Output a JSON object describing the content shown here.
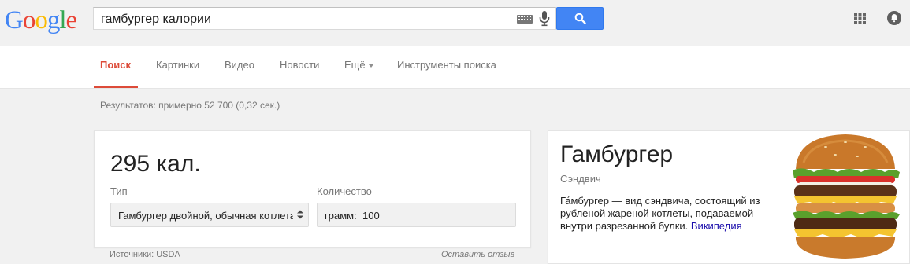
{
  "header": {
    "logo_letters": [
      {
        "ch": "G",
        "color": "#4285f4"
      },
      {
        "ch": "o",
        "color": "#ea4335"
      },
      {
        "ch": "o",
        "color": "#fbbc05"
      },
      {
        "ch": "g",
        "color": "#4285f4"
      },
      {
        "ch": "l",
        "color": "#34a853"
      },
      {
        "ch": "e",
        "color": "#ea4335"
      }
    ],
    "search_query": "гамбургер калории",
    "icons": {
      "keyboard": "keyboard-icon",
      "mic": "microphone-icon",
      "search": "search-icon",
      "apps": "apps-grid-icon",
      "notifications": "bell-icon"
    }
  },
  "nav": {
    "tabs": [
      {
        "label": "Поиск",
        "active": true
      },
      {
        "label": "Картинки",
        "active": false
      },
      {
        "label": "Видео",
        "active": false
      },
      {
        "label": "Новости",
        "active": false
      },
      {
        "label": "Ещё",
        "active": false
      },
      {
        "label": "Инструменты поиска",
        "active": false
      }
    ]
  },
  "results": {
    "stats": "Результатов: примерно 52 700 (0,32 сек.)",
    "calories_card": {
      "value": "295 кал.",
      "type_label": "Тип",
      "type_value": "Гамбургер двойной, обычная котлета",
      "quantity_label": "Количество",
      "quantity_unit": "грамм:",
      "quantity_value": "100",
      "source": "Источники: USDA",
      "feedback": "Оставить отзыв"
    },
    "knowledge_panel": {
      "title": "Гамбургер",
      "subtitle": "Сэндвич",
      "description": "Га́мбургер — вид сэндвича, состоящий из рубленой жареной котлеты, подаваемой внутри разрезанной булки.",
      "link": "Википедия"
    }
  },
  "colors": {
    "accent_red": "#dd4b39",
    "search_blue": "#4285f4",
    "link_blue": "#1a0dab"
  }
}
